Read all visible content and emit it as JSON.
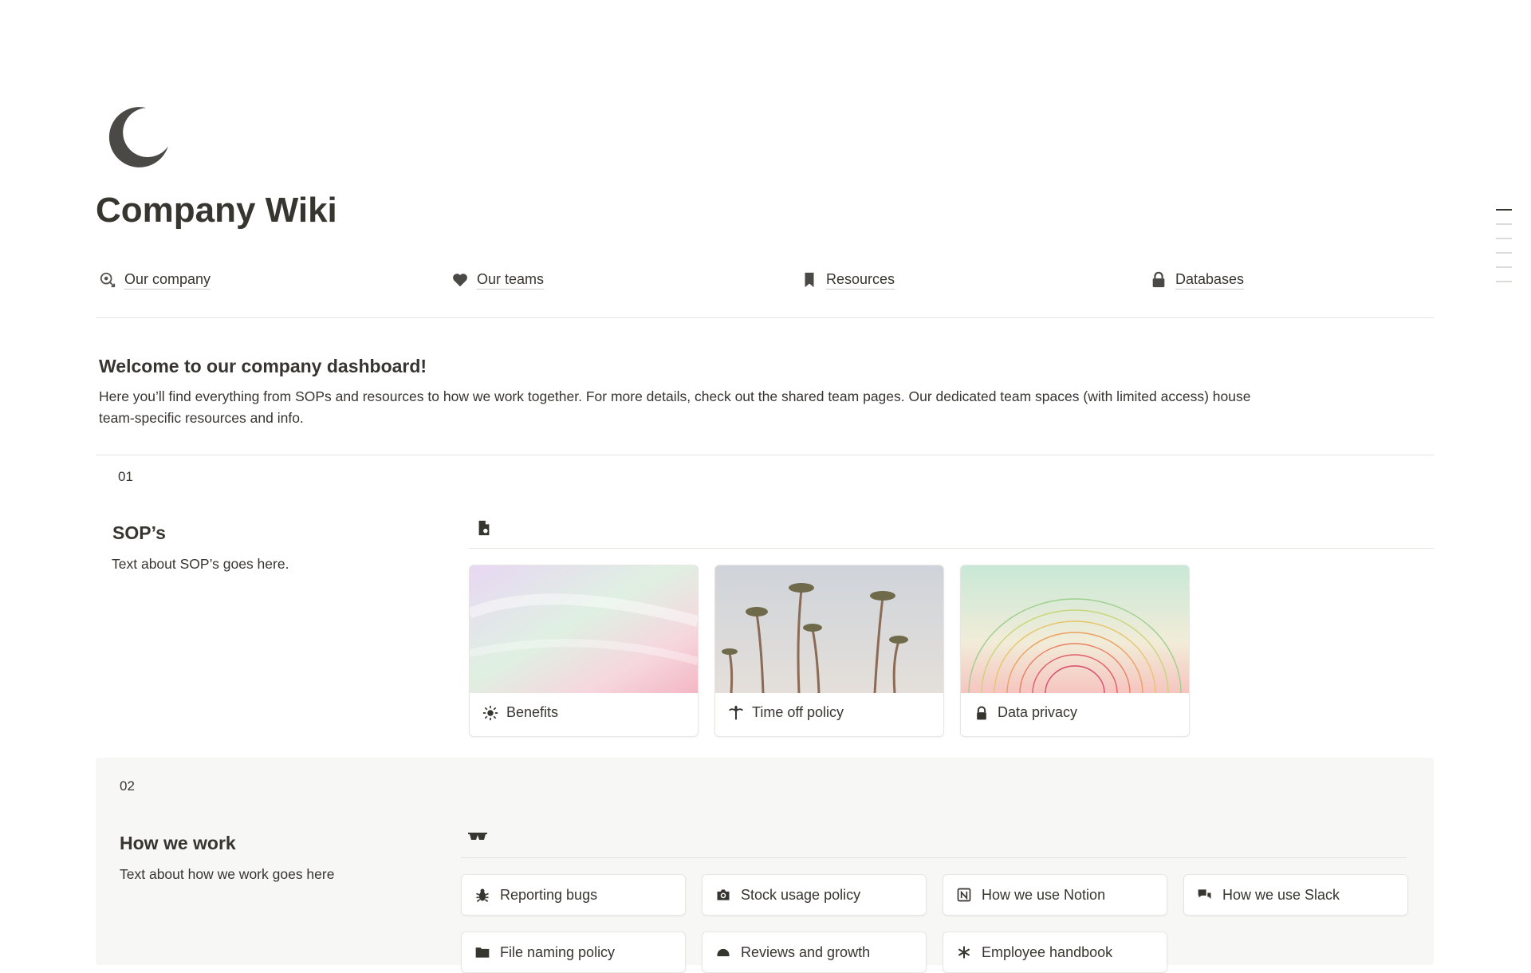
{
  "page": {
    "title": "Company Wiki",
    "icon": "moon-icon"
  },
  "nav": [
    {
      "label": "Our company",
      "icon": "company-icon"
    },
    {
      "label": "Our teams",
      "icon": "heart-icon"
    },
    {
      "label": "Resources",
      "icon": "bookmark-icon"
    },
    {
      "label": "Databases",
      "icon": "lock-icon"
    }
  ],
  "welcome": {
    "heading": "Welcome to our company dashboard!",
    "body": "Here you’ll find everything from SOPs and resources to how we work together. For more details, check out the shared team pages. Our dedicated team spaces (with limited access) house team-specific resources and info."
  },
  "sections": [
    {
      "number": "01",
      "title": "SOP’s",
      "text": "Text about SOP’s goes here.",
      "icon": "document-icon",
      "cards": [
        {
          "label": "Benefits",
          "icon": "sun-icon"
        },
        {
          "label": "Time off policy",
          "icon": "palm-tree-icon"
        },
        {
          "label": "Data privacy",
          "icon": "lock-icon"
        }
      ]
    },
    {
      "number": "02",
      "title": "How we work",
      "text": "Text about how we work goes here",
      "icon": "glasses-icon",
      "links": [
        {
          "label": "Reporting bugs",
          "icon": "bug-icon"
        },
        {
          "label": "Stock usage policy",
          "icon": "camera-icon"
        },
        {
          "label": "How we use Notion",
          "icon": "notion-icon"
        },
        {
          "label": "How we use Slack",
          "icon": "chat-icon"
        },
        {
          "label": "File naming policy",
          "icon": "folder-icon"
        },
        {
          "label": "Reviews and growth",
          "icon": "helmet-icon"
        },
        {
          "label": "Employee handbook",
          "icon": "asterisk-icon"
        }
      ]
    }
  ],
  "colors": {
    "text": "#37352f",
    "panel": "#f7f7f5",
    "border": "#e7e6e3"
  }
}
